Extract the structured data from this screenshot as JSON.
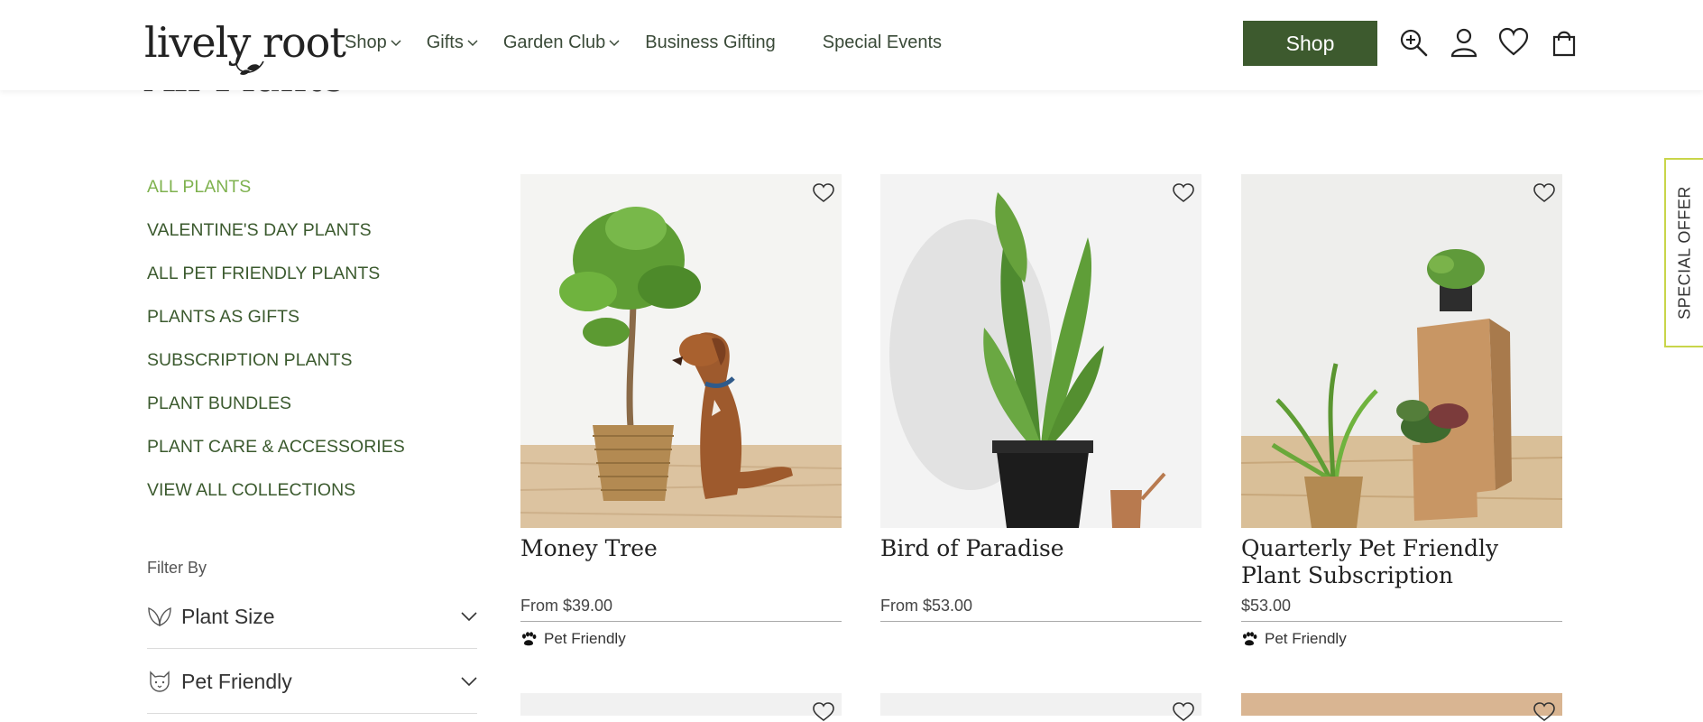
{
  "header": {
    "logo": "lively root",
    "nav": [
      {
        "label": "Shop",
        "dropdown": true
      },
      {
        "label": "Gifts",
        "dropdown": true
      },
      {
        "label": "Garden Club",
        "dropdown": true
      },
      {
        "label": "Business Gifting",
        "dropdown": false
      },
      {
        "label": "Special Events",
        "dropdown": false
      }
    ],
    "shop_button": "Shop",
    "icons": [
      "search-icon",
      "account-icon",
      "wishlist-icon",
      "cart-icon"
    ]
  },
  "page_title": "All Plants",
  "sidebar": {
    "categories": [
      {
        "label": "ALL PLANTS",
        "active": true
      },
      {
        "label": "VALENTINE'S DAY PLANTS"
      },
      {
        "label": "ALL PET FRIENDLY PLANTS"
      },
      {
        "label": "PLANTS AS GIFTS"
      },
      {
        "label": "SUBSCRIPTION PLANTS"
      },
      {
        "label": "PLANT BUNDLES"
      },
      {
        "label": "PLANT CARE & ACCESSORIES"
      },
      {
        "label": "VIEW ALL COLLECTIONS"
      }
    ],
    "filter_title": "Filter By",
    "filters": [
      {
        "label": "Plant Size",
        "icon": "leaf-icon"
      },
      {
        "label": "Pet Friendly",
        "icon": "cat-icon"
      }
    ]
  },
  "products": [
    {
      "name": "Money Tree",
      "price": "From $39.00",
      "badge": "Pet Friendly"
    },
    {
      "name": "Bird of Paradise",
      "price": "From $53.00",
      "badge": ""
    },
    {
      "name": "Quarterly Pet Friendly Plant Subscription",
      "price": "$53.00",
      "badge": "Pet Friendly"
    }
  ],
  "special_offer": "SPECIAL OFFER",
  "colors": {
    "brand_green": "#3d5a2e",
    "active_green": "#7fb24f",
    "offer_border": "#c9d54a"
  }
}
